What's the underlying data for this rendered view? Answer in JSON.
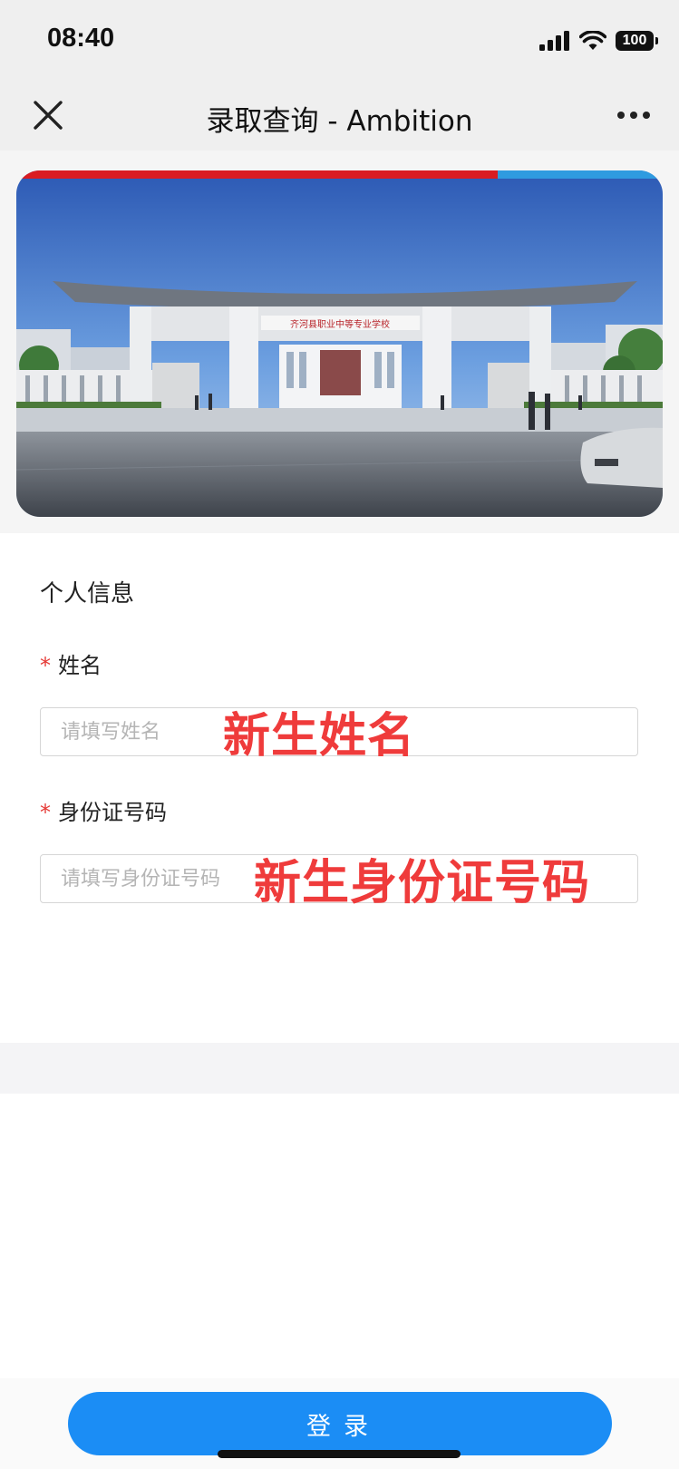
{
  "status_bar": {
    "time": "08:40",
    "battery": "100"
  },
  "nav": {
    "title": "录取查询 - Ambition"
  },
  "banner": {
    "sign_text": "齐河县职业中等专业学校"
  },
  "form": {
    "section_title": "个人信息",
    "required_mark": "*",
    "name": {
      "label": "姓名",
      "placeholder": "请填写姓名",
      "note": "新生姓名"
    },
    "id_number": {
      "label": "身份证号码",
      "placeholder": "请填写身份证号码",
      "note": "新生身份证号码"
    }
  },
  "login_button": "登录",
  "colors": {
    "accent": "#1b8df5",
    "required": "#e53935",
    "note": "#ef3b3b"
  }
}
